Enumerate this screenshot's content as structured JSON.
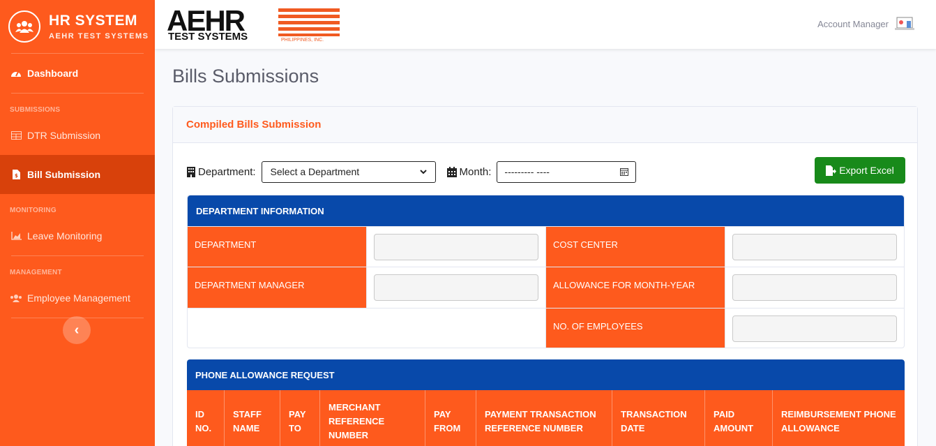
{
  "brand": {
    "title": "HR SYSTEM",
    "subtitle": "AEHR TEST SYSTEMS",
    "logo_icon": "users-icon"
  },
  "sidebar": {
    "dashboard": "Dashboard",
    "sections": {
      "submissions": "SUBMISSIONS",
      "monitoring": "MONITORING",
      "management": "MANAGEMENT"
    },
    "items": {
      "dtr": "DTR Submission",
      "bill": "Bill Submission",
      "leave": "Leave Monitoring",
      "employee": "Employee Management"
    },
    "toggle": "‹"
  },
  "topbar": {
    "logo_main": "AEHR",
    "logo_sub": "TEST SYSTEMS",
    "logo_tag": "PHILIPPINES, INC.",
    "account": "Account Manager"
  },
  "page": {
    "title": "Bills Submissions"
  },
  "card": {
    "title": "Compiled Bills Submission"
  },
  "filters": {
    "department_label": "Department:",
    "department_value": "Select a Department",
    "month_label": "Month:",
    "month_value": "--------- ----",
    "export_label": "Export Excel"
  },
  "dept_info": {
    "title": "DEPARTMENT INFORMATION",
    "department": "DEPARTMENT",
    "cost_center": "COST CENTER",
    "manager": "DEPARTMENT MANAGER",
    "allowance": "ALLOWANCE FOR MONTH-YEAR",
    "employees": "NO. OF EMPLOYEES"
  },
  "phone": {
    "title": "PHONE ALLOWANCE REQUEST",
    "columns": [
      [
        "ID",
        "NO."
      ],
      [
        "STAFF",
        "NAME"
      ],
      [
        "PAY",
        "TO"
      ],
      [
        "MERCHANT",
        "REFERENCE",
        "NUMBER"
      ],
      [
        "PAY",
        "FROM"
      ],
      [
        "PAYMENT TRANSACTION",
        "REFERENCE NUMBER"
      ],
      [
        "TRANSACTION",
        "DATE"
      ],
      [
        "PAID",
        "AMOUNT"
      ],
      [
        "REIMBURSEMENT PHONE",
        "ALLOWANCE"
      ]
    ]
  },
  "colors": {
    "sidebar": "#fe5a1d",
    "active": "#d8410b",
    "blue": "#0849aa",
    "green": "#188a1a"
  }
}
